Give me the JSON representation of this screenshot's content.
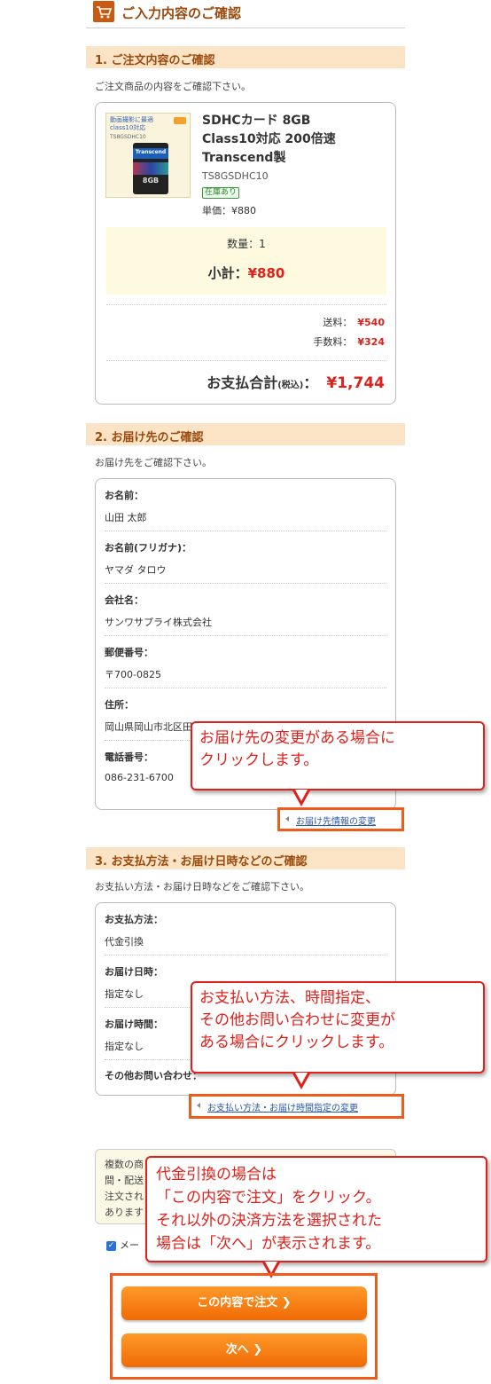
{
  "page": {
    "title": "ご入力内容のご確認"
  },
  "section1": {
    "title": "1. ご注文内容のご確認",
    "desc": "ご注文商品の内容をご確認下さい。",
    "product": {
      "image_caption_1": "動画撮影に最適",
      "image_caption_2": "class10対応",
      "image_code": "TS8GSDHC10",
      "card_brand": "Transcend",
      "card_capacity": "8GB",
      "name_line1": "SDHCカード 8GB",
      "name_line2": "Class10対応 200倍速",
      "name_line3": "Transcend製",
      "code": "TS8GSDHC10",
      "stock": "在庫あり",
      "unit_price": "単価：¥880"
    },
    "quantity": "数量：1",
    "subtotal_label": "小計：",
    "subtotal_value": "¥880",
    "shipping_label": "送料：",
    "shipping_value": "¥540",
    "fee_label": "手数料：",
    "fee_value": "¥324",
    "total_label": "お支払合計",
    "total_tax": "(税込)",
    "total_colon": "：",
    "total_value": "¥1,744"
  },
  "section2": {
    "title": "2. お届け先のご確認",
    "desc": "お届け先をご確認下さい。",
    "fields": [
      {
        "label": "お名前：",
        "value": "山田 太郎"
      },
      {
        "label": "お名前(フリガナ)：",
        "value": "ヤマダ タロウ"
      },
      {
        "label": "会社名：",
        "value": "サンワサプライ株式会社"
      },
      {
        "label": "郵便番号：",
        "value": "〒700-0825"
      },
      {
        "label": "住所：",
        "value": "岡山県岡山市北区田町1-10-1"
      },
      {
        "label": "電話番号：",
        "value": "086-231-6700"
      }
    ],
    "change_link": "お届け先情報の変更",
    "callout_line1": "お届け先の変更がある場合に",
    "callout_line2": "クリックします。"
  },
  "section3": {
    "title": "3. お支払方法・お届け日時などのご確認",
    "desc": "お支払い方法・お届け日時などをご確認下さい。",
    "fields": [
      {
        "label": "お支払方法：",
        "value": "代金引換"
      },
      {
        "label": "お届け日時：",
        "value": "指定なし"
      },
      {
        "label": "お届け時間：",
        "value": "指定なし"
      },
      {
        "label": "その他お問い合わせ：",
        "value": ""
      }
    ],
    "change_link": "お支払い方法・お届け時間指定の変更",
    "callout_line1": "お支払い方法、時間指定、",
    "callout_line2": "その他お問い合わせに変更が",
    "callout_line3": "ある場合にクリックします。"
  },
  "notice": {
    "line1": "複数の商",
    "line2": "間・配送",
    "line3": "注文され",
    "line4": "あります"
  },
  "mail_check_label": "メー",
  "final_callout": {
    "line1": "代金引換の場合は",
    "line2": "「この内容で注文」をクリック。",
    "line3": "それ以外の決済方法を選択された",
    "line4": "場合は「次へ」が表示されます。"
  },
  "buttons": {
    "order": "この内容で注文 ❯",
    "next": "次へ ❯"
  },
  "colors": {
    "accent": "#f05a1a",
    "price_red": "#e0201a",
    "section_bg": "#fbe3c6",
    "link_blue": "#2a58a8"
  }
}
